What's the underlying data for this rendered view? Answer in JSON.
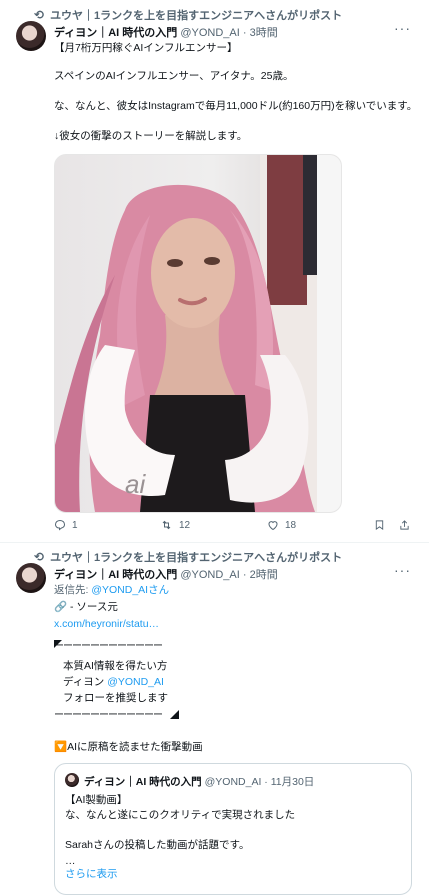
{
  "tweets": [
    {
      "repost_text": "ユウヤ｜1ランクを上を目指すエンジニアへさんがリポスト",
      "name": "ディヨン｜AI 時代の入門",
      "handle": "@YOND_AI",
      "time": "· 3時間",
      "lines": [
        "【月7桁万円稼ぐAIインフルエンサー】",
        "スペインのAIインフルエンサー、アイタナ。25歳。",
        "な、なんと、彼女はInstagramで毎月11,000ドル(約160万円)を稼いでいます。",
        "↓彼女の衝撃のストーリーを解説します。"
      ],
      "photo_watermark": "ai",
      "replies": "1",
      "reposts": "12",
      "likes": "18"
    },
    {
      "repost_text": "ユウヤ｜1ランクを上を目指すエンジニアへさんがリポスト",
      "name": "ディヨン｜AI 時代の入門",
      "handle": "@YOND_AI",
      "time": "· 2時間",
      "reply_to_label": "返信先:",
      "reply_to_handle": "@YOND_AIさん",
      "source_label": "🔗 - ソース元",
      "source_link": "x.com/heyronir/statu…",
      "box_line_top": "ーーーーーーーーーーーー",
      "box_lines": [
        "本質AI情報を得たい方",
        "ディヨン",
        "@YOND_AI",
        "フォローを推奨します"
      ],
      "box_line_bottom": "ーーーーーーーーーーーー",
      "video_caption": "🔽AIに原稿を読ませた衝撃動画",
      "quote": {
        "name": "ディヨン｜AI 時代の入門",
        "handle": "@YOND_AI",
        "time": "· 11月30日",
        "lines": [
          "【AI製動画】",
          "な、なんと遂にこのクオリティで実現されました",
          "Sarahさんの投稿した動画が話題です。",
          "…"
        ],
        "show_more": "さらに表示"
      }
    }
  ],
  "more_icon": "more-dots-icon",
  "colors": {
    "link": "#1d9bf0",
    "muted": "#536471",
    "text": "#0f1419"
  }
}
